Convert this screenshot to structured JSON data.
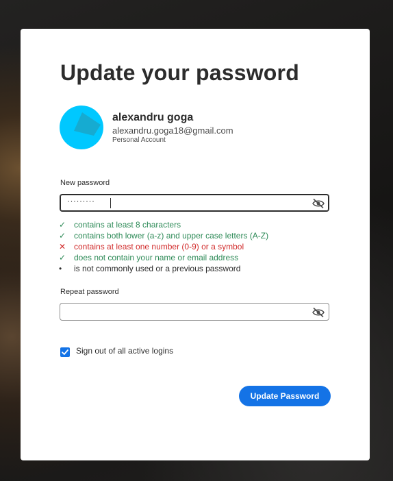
{
  "page": {
    "title": "Update your password"
  },
  "user": {
    "name": "alexandru goga",
    "email": "alexandru.goga18@gmail.com",
    "account_type": "Personal Account"
  },
  "new_password": {
    "label": "New password",
    "masked_value": "·········"
  },
  "rules": [
    {
      "status": "ok",
      "mark": "✓",
      "text": "contains at least 8 characters"
    },
    {
      "status": "ok",
      "mark": "✓",
      "text": "contains both lower (a-z) and upper case letters (A-Z)"
    },
    {
      "status": "bad",
      "mark": "✕",
      "text": "contains at least one number (0-9) or a symbol"
    },
    {
      "status": "ok",
      "mark": "✓",
      "text": "does not contain your name or email address"
    },
    {
      "status": "neutral",
      "mark": "•",
      "text": "is not commonly used or a previous password"
    }
  ],
  "repeat_password": {
    "label": "Repeat password",
    "value": ""
  },
  "sign_out": {
    "label": "Sign out of all active logins",
    "checked": true
  },
  "submit": {
    "label": "Update Password"
  },
  "colors": {
    "accent": "#1473e6",
    "ok": "#2d8a57",
    "error": "#d12b2b",
    "avatar": "#00c8ff"
  }
}
